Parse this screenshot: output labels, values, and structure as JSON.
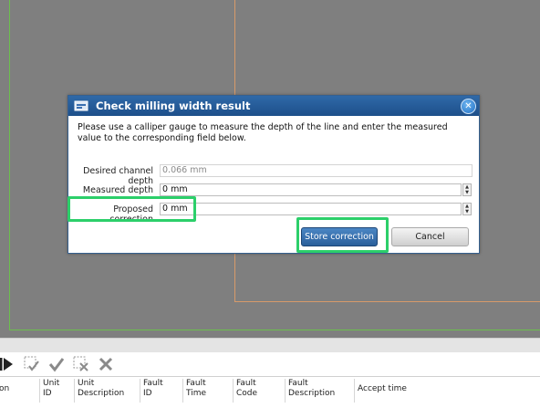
{
  "dialog": {
    "title": "Check milling width result",
    "close_glyph": "✕",
    "instructions": "Please use a calliper gauge to measure the depth of the line and enter the measured value to the corresponding field below.",
    "fields": {
      "desired_label": "Desired channel depth",
      "desired_value": "0.066 mm",
      "measured_label": "Measured depth",
      "measured_value": "0 mm",
      "proposed_label": "Proposed correction",
      "proposed_value": "0 mm"
    },
    "store_label": "Store correction",
    "cancel_label": "Cancel"
  },
  "toolbar": {
    "icons": [
      "play-step-icon",
      "confirm-outline-icon",
      "check-icon",
      "delete-outline-icon",
      "close-icon"
    ]
  },
  "grid": {
    "columns": [
      "on",
      "Unit\nID",
      "Unit\nDescription",
      "Fault\nID",
      "Fault\nTime",
      "Fault\nCode",
      "Fault\nDescription",
      "Accept time"
    ]
  },
  "colors": {
    "highlight": "#2ccf6a",
    "title_bar": "#2f69a8",
    "workspace": "#7f7f7f"
  }
}
